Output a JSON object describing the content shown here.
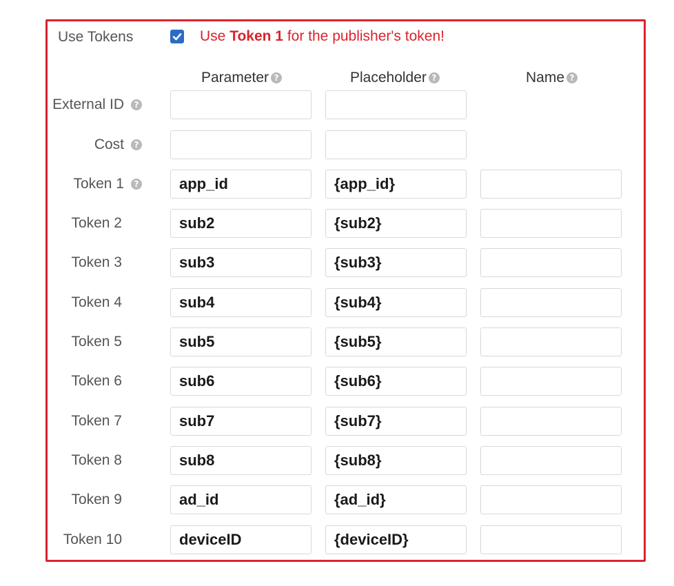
{
  "use_tokens": {
    "label": "Use Tokens",
    "checked": true,
    "hint_prefix": "Use ",
    "hint_bold": "Token 1",
    "hint_suffix": " for the publisher's token!"
  },
  "columns": {
    "parameter": "Parameter",
    "placeholder": "Placeholder",
    "name": "Name"
  },
  "rows": [
    {
      "label": "External ID",
      "help": true,
      "parameter": "",
      "placeholder": ""
    },
    {
      "label": "Cost",
      "help": true,
      "parameter": "",
      "placeholder": ""
    },
    {
      "label": "Token 1",
      "help": true,
      "parameter": "app_id",
      "placeholder": "{app_id}",
      "name": ""
    },
    {
      "label": "Token 2",
      "help": false,
      "parameter": "sub2",
      "placeholder": "{sub2}",
      "name": ""
    },
    {
      "label": "Token 3",
      "help": false,
      "parameter": "sub3",
      "placeholder": "{sub3}",
      "name": ""
    },
    {
      "label": "Token 4",
      "help": false,
      "parameter": "sub4",
      "placeholder": "{sub4}",
      "name": ""
    },
    {
      "label": "Token 5",
      "help": false,
      "parameter": "sub5",
      "placeholder": "{sub5}",
      "name": ""
    },
    {
      "label": "Token 6",
      "help": false,
      "parameter": "sub6",
      "placeholder": "{sub6}",
      "name": ""
    },
    {
      "label": "Token 7",
      "help": false,
      "parameter": "sub7",
      "placeholder": "{sub7}",
      "name": ""
    },
    {
      "label": "Token 8",
      "help": false,
      "parameter": "sub8",
      "placeholder": "{sub8}",
      "name": ""
    },
    {
      "label": "Token 9",
      "help": false,
      "parameter": "ad_id",
      "placeholder": "{ad_id}",
      "name": ""
    },
    {
      "label": "Token 10",
      "help": false,
      "parameter": "deviceID",
      "placeholder": "{deviceID}",
      "name": ""
    }
  ],
  "colors": {
    "highlight_border": "#d9232d",
    "checkbox": "#2b6cc4",
    "warning_text": "#d9232d"
  },
  "icons": {
    "help": "help-icon",
    "check": "check-icon"
  }
}
